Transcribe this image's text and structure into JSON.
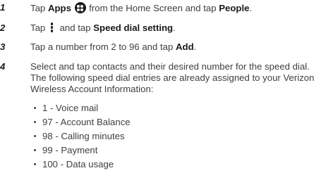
{
  "steps": [
    {
      "number": "1",
      "pre1": "Tap ",
      "bold1": "Apps",
      "icon": "apps-grid-icon",
      "pre2": " from the Home Screen and tap ",
      "bold2": "People",
      "post": "."
    },
    {
      "number": "2",
      "pre1": "Tap ",
      "icon": "menu-dots-icon",
      "pre2": " and tap ",
      "bold2": "Speed dial setting",
      "post": "."
    },
    {
      "number": "3",
      "pre1": "Tap a number from 2 to 96 and tap ",
      "bold2": "Add",
      "post": "."
    },
    {
      "number": "4",
      "lines": [
        "Select and tap contacts and their desired number for the speed dial.",
        "The following speed dial entries are already assigned to your Verizon",
        "Wireless Account Information:"
      ],
      "bullets": [
        "1 - Voice mail",
        "97 - Account Balance",
        "98 - Calling minutes",
        "99 - Payment",
        "100 - Data usage"
      ]
    }
  ]
}
